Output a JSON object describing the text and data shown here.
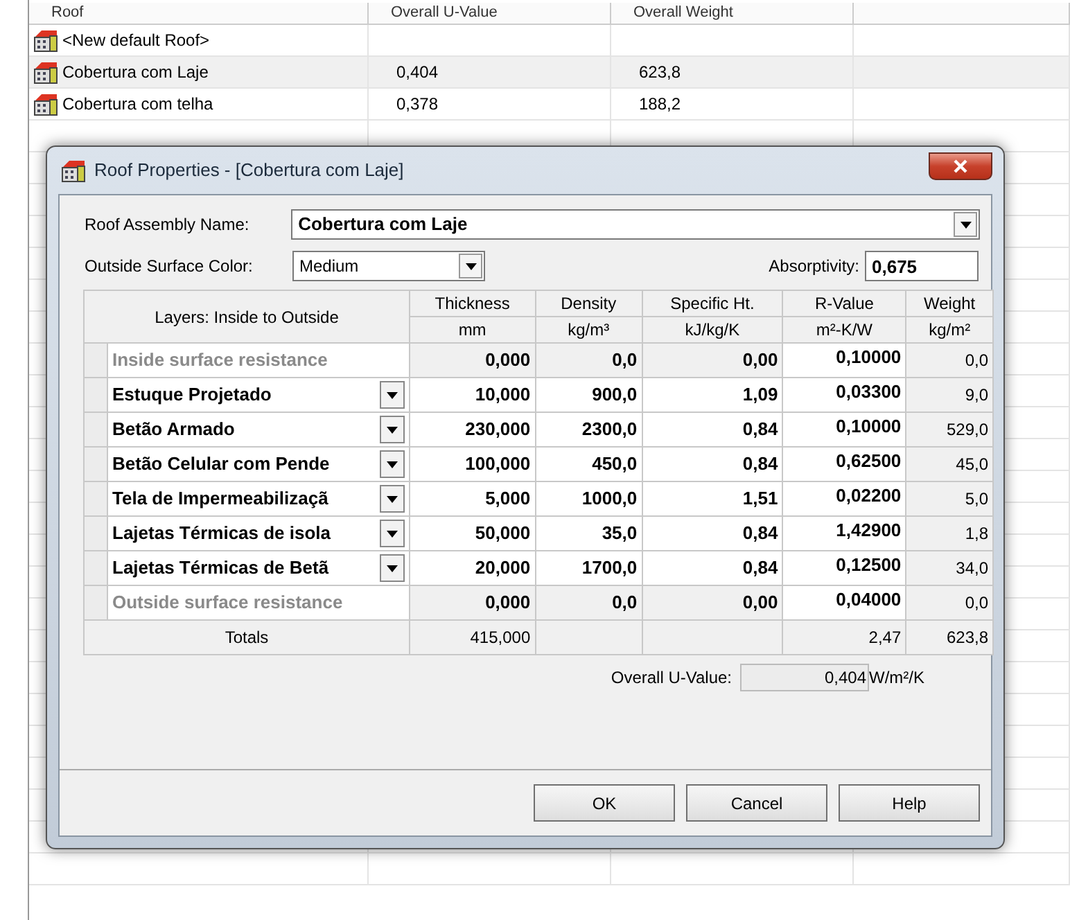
{
  "list": {
    "columns": [
      "Roof",
      "Overall U-Value",
      "Overall Weight"
    ],
    "rows": [
      {
        "name": "<New default Roof>",
        "selected": false
      },
      {
        "name": "Cobertura com Laje",
        "u_value": "0,404",
        "weight": "623,8",
        "selected": true
      },
      {
        "name": "Cobertura com telha",
        "u_value": "0,378",
        "weight": "188,2",
        "selected": false
      }
    ]
  },
  "dialog": {
    "title": "Roof Properties - [Cobertura com Laje]",
    "assembly_name_label": "Roof Assembly Name:",
    "assembly_name": "Cobertura com Laje",
    "color_label": "Outside Surface Color:",
    "surface_color": "Medium",
    "absorptivity_label": "Absorptivity:",
    "absorptivity": "0,675",
    "layers_header": "Layers: Inside to Outside",
    "columns": [
      {
        "label": "Thickness",
        "unit": "mm"
      },
      {
        "label": "Density",
        "unit": "kg/m³"
      },
      {
        "label": "Specific Ht.",
        "unit": "kJ/kg/K"
      },
      {
        "label": "R-Value",
        "unit": "m²-K/W"
      },
      {
        "label": "Weight",
        "unit": "kg/m²"
      }
    ],
    "layers": [
      {
        "kind": "fixed",
        "name": "Inside surface resistance",
        "values": [
          "0,000",
          "0,0",
          "0,00",
          "0,10000",
          "0,0"
        ]
      },
      {
        "kind": "layer",
        "name": "Estuque Projetado",
        "values": [
          "10,000",
          "900,0",
          "1,09",
          "0,03300",
          "9,0"
        ]
      },
      {
        "kind": "layer",
        "name": "Betão Armado",
        "values": [
          "230,000",
          "2300,0",
          "0,84",
          "0,10000",
          "529,0"
        ]
      },
      {
        "kind": "layer",
        "name": "Betão Celular com Pende",
        "values": [
          "100,000",
          "450,0",
          "0,84",
          "0,62500",
          "45,0"
        ]
      },
      {
        "kind": "layer",
        "name": "Tela de Impermeabilizaçã",
        "values": [
          "5,000",
          "1000,0",
          "1,51",
          "0,02200",
          "5,0"
        ]
      },
      {
        "kind": "layer",
        "name": "Lajetas Térmicas de isola",
        "values": [
          "50,000",
          "35,0",
          "0,84",
          "1,42900",
          "1,8"
        ]
      },
      {
        "kind": "layer",
        "name": "Lajetas Térmicas de Betã",
        "values": [
          "20,000",
          "1700,0",
          "0,84",
          "0,12500",
          "34,0"
        ]
      },
      {
        "kind": "fixed",
        "name": "Outside surface resistance",
        "values": [
          "0,000",
          "0,0",
          "0,00",
          "0,04000",
          "0,0"
        ]
      }
    ],
    "totals": {
      "label": "Totals",
      "thickness": "415,000",
      "r_value": "2,47",
      "weight": "623,8"
    },
    "overall": {
      "label": "Overall U-Value:",
      "value": "0,404",
      "unit": "W/m²/K"
    },
    "buttons": [
      "OK",
      "Cancel",
      "Help"
    ]
  }
}
